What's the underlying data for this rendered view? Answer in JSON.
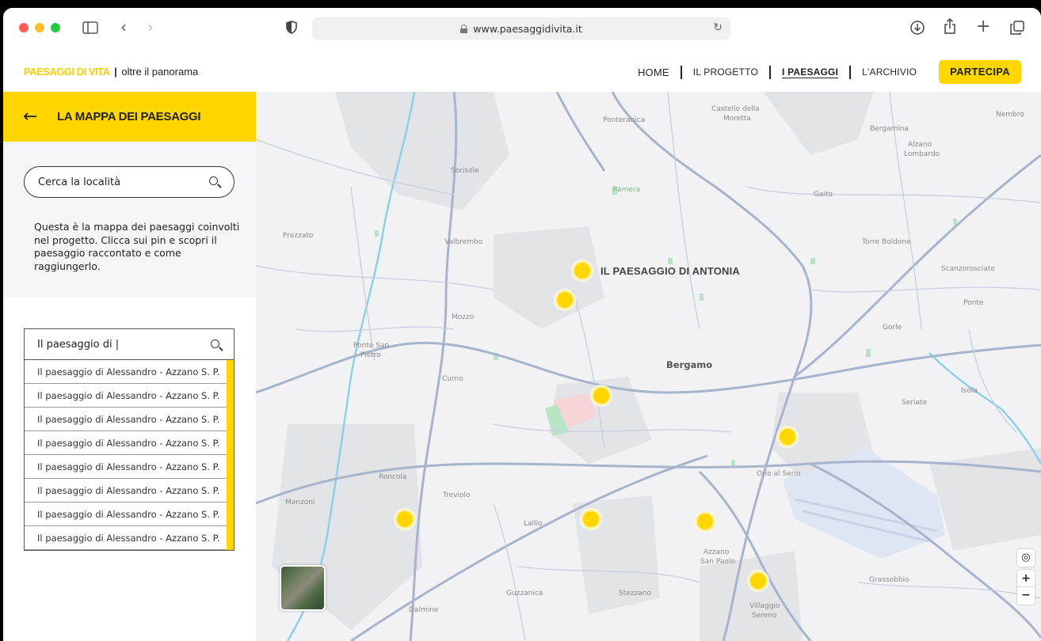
{
  "browser": {
    "url": "www.paesaggidivita.it",
    "icons": [
      "sidebar-icon",
      "back-icon",
      "forward-icon",
      "shield-icon",
      "download-icon",
      "share-icon",
      "new-tab-icon",
      "tabs-icon"
    ]
  },
  "header": {
    "logo_brand": "PAESAGGI DI VITA",
    "logo_sep": "|",
    "logo_tag": "oltre il panorama",
    "nav": [
      "HOME",
      "IL PROGETTO",
      "I PAESAGGI",
      "L'ARCHIVIO"
    ],
    "cta": "PARTECIPA",
    "active": "I PAESAGGI"
  },
  "sidebar": {
    "title": "LA MAPPA DEI PAESAGGI",
    "search_placeholder": "Cerca la località",
    "description": "Questa è la mappa dei paesaggi coinvolti nel progetto. Clicca sui pin e scopri il paesaggio raccontato e come raggiungerlo.",
    "query": "Il paesaggio di |",
    "results": [
      "Il paesaggio di Alessandro - Azzano S. P.",
      "Il paesaggio di Alessandro - Azzano S. P.",
      "Il paesaggio di Alessandro - Azzano S. P.",
      "Il paesaggio di Alessandro - Azzano S. P.",
      "Il paesaggio di Alessandro - Azzano S. P.",
      "Il paesaggio di Alessandro - Azzano S. P.",
      "Il paesaggio di Alessandro - Azzano S. P.",
      "Il paesaggio di Alessandro - Azzano S. P."
    ]
  },
  "map": {
    "highlight_label": "IL PAESAGGIO DI ANTONIA",
    "city": "Bergamo",
    "places": {
      "ponteranica": "Ponteranica",
      "castello": "Castello della",
      "moretta": "Moretta",
      "bergamina": "Bergamina",
      "nembro": "Nembro",
      "alzano": "Alzano",
      "lombardo": "Lombardo",
      "sorisole": "Sorisole",
      "ramera": "Ramera",
      "gaito": "Gaito",
      "prezzato": "Prezzato",
      "valbrembo": "Valbrembo",
      "torre": "Torre Boldone",
      "scanzo": "Scanzorosciate",
      "ponte": "Ponte",
      "mozzo": "Mozzo",
      "ponte_san": "Ponte San",
      "pietro": "Pietro",
      "gorle": "Gorle",
      "curno": "Curno",
      "isola": "Isola",
      "seriate": "Seriate",
      "roncola": "Roncola",
      "treviolo": "Treviolo",
      "orio": "Orio al Serio",
      "manzoni": "Manzoni",
      "lallio": "Lallio",
      "azzano": "Azzano",
      "san_paolo": "San Paolo",
      "grassobbio": "Grassobbio",
      "guzzanica": "Guzzanica",
      "stezzano": "Stezzano",
      "villaggio": "Villaggio",
      "sereno": "Sereno",
      "dalmine": "Dalmine"
    },
    "controls": {
      "locate": "◎",
      "zoom_in": "+",
      "zoom_out": "−"
    }
  }
}
